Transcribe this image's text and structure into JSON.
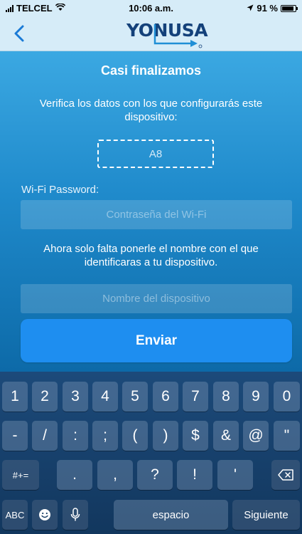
{
  "status_bar": {
    "carrier": "TELCEL",
    "time": "10:06 a.m.",
    "battery": "91 %",
    "battery_level": 0.91
  },
  "nav": {
    "logo": "YONUSA"
  },
  "form": {
    "title": "Casi finalizamos",
    "subtitle": "Verifica los datos con los que configurarás este dispositivo:",
    "device_id": "A8",
    "wifi_label": "Wi-Fi Password:",
    "wifi_placeholder": "Contraseña del Wi-Fi",
    "instruction": "Ahora solo falta ponerle el nombre con el que identificaras a tu dispositivo.",
    "name_placeholder": "Nombre del dispositivo",
    "send_label": "Enviar"
  },
  "keyboard": {
    "row1": [
      "1",
      "2",
      "3",
      "4",
      "5",
      "6",
      "7",
      "8",
      "9",
      "0"
    ],
    "row2": [
      "-",
      "/",
      ":",
      ";",
      "(",
      ")",
      "$",
      "&",
      "@",
      "\""
    ],
    "row3": [
      ".",
      ",",
      "?",
      "!",
      "'"
    ],
    "symbols_key": "#+=",
    "abc_key": "ABC",
    "space_key": "espacio",
    "next_key": "Siguiente"
  }
}
